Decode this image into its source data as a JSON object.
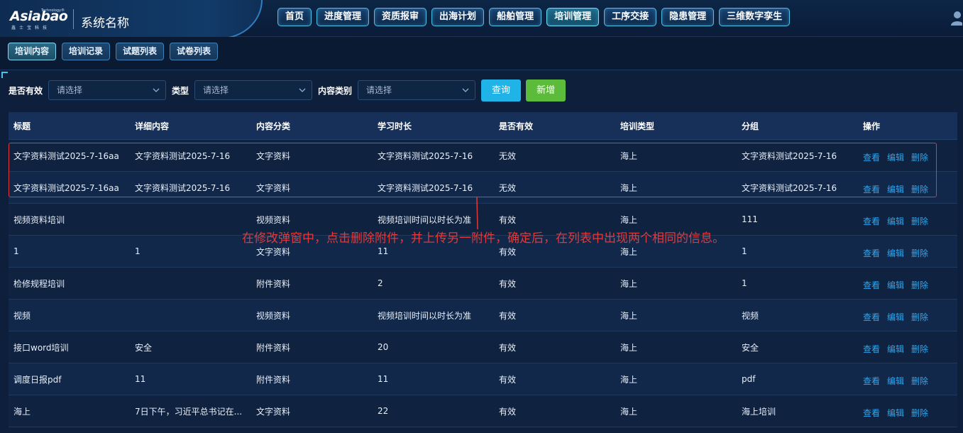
{
  "header": {
    "logo_text": "Asiabao",
    "logo_sub": "Technology®",
    "logo_cn": "鑫士宝科技",
    "system_name": "系统名称",
    "nav": [
      "首页",
      "进度管理",
      "资质报审",
      "出海计划",
      "船舶管理",
      "培训管理",
      "工序交接",
      "隐患管理",
      "三维数字孪生"
    ],
    "active_nav": "培训管理"
  },
  "subtabs": {
    "items": [
      "培训内容",
      "培训记录",
      "试题列表",
      "试卷列表"
    ],
    "active": "培训内容"
  },
  "filters": {
    "valid_label": "是否有效",
    "valid_placeholder": "请选择",
    "type_label": "类型",
    "type_placeholder": "请选择",
    "category_label": "内容类别",
    "category_placeholder": "请选择",
    "query_button": "查询",
    "add_button": "新增"
  },
  "table": {
    "headers": [
      "标题",
      "详细内容",
      "内容分类",
      "学习时长",
      "是否有效",
      "培训类型",
      "分组",
      "操作"
    ],
    "rows": [
      [
        "文字资料测试2025-7-16aa",
        "文字资料测试2025-7-16",
        "文字资料",
        "文字资料测试2025-7-16",
        "无效",
        "海上",
        "文字资料测试2025-7-16"
      ],
      [
        "文字资料测试2025-7-16aa",
        "文字资料测试2025-7-16",
        "文字资料",
        "文字资料测试2025-7-16",
        "无效",
        "海上",
        "文字资料测试2025-7-16"
      ],
      [
        "视频资料培训",
        "",
        "视频资料",
        "视频培训时间以时长为准",
        "有效",
        "海上",
        "111"
      ],
      [
        "1",
        "1",
        "文字资料",
        "11",
        "有效",
        "海上",
        "1"
      ],
      [
        "检修规程培训",
        "",
        "附件资料",
        "2",
        "有效",
        "海上",
        "1"
      ],
      [
        "视频",
        "",
        "视频资料",
        "视频培训时间以时长为准",
        "有效",
        "海上",
        "视频"
      ],
      [
        "接口word培训",
        "安全",
        "附件资料",
        "20",
        "有效",
        "海上",
        "安全"
      ],
      [
        "调度日报pdf",
        "11",
        "附件资料",
        "11",
        "有效",
        "海上",
        "pdf"
      ],
      [
        "海上",
        "7日下午，习近平总书记在...",
        "文字资料",
        "22",
        "有效",
        "海上",
        "海上培训"
      ]
    ],
    "ops": [
      "查看",
      "编辑",
      "删除"
    ]
  },
  "annotation": {
    "text": "在修改弹窗中，点击删除附件，并上传另一附件，确定后，在列表中出现两个相同的信息。",
    "color": "#e03a3a"
  },
  "colors": {
    "nav_border": "#4fc1e9",
    "query_button": "#1fb3e8",
    "add_button": "#5dbb3b",
    "link": "#2fa6ee",
    "highlight": "#e0393b"
  }
}
